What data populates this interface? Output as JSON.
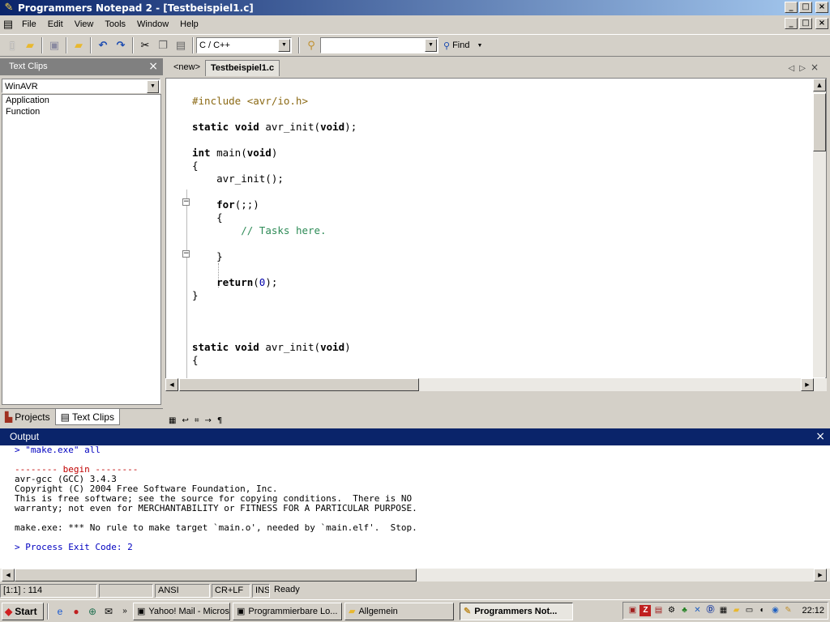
{
  "window": {
    "title": "Programmers Notepad 2 - [Testbeispiel1.c]",
    "caption_min": "_",
    "caption_max": "□",
    "caption_close": "×"
  },
  "menu": [
    "File",
    "Edit",
    "View",
    "Tools",
    "Window",
    "Help"
  ],
  "toolbar": {
    "scheme": "C / C++",
    "search_value": "",
    "find_label": "Find"
  },
  "text_clips": {
    "title": "Text Clips",
    "set": "WinAVR",
    "items": [
      "Application",
      "Function"
    ],
    "tabs": [
      "Projects",
      "Text Clips"
    ]
  },
  "document_tabs": [
    "<new>",
    "Testbeispiel1.c"
  ],
  "code_lines": [
    {
      "type": "blank",
      "text": ""
    },
    {
      "type": "pp",
      "text": "#include <avr/io.h>"
    },
    {
      "type": "blank",
      "text": ""
    },
    {
      "type": "proto",
      "kw": "static void",
      "name": " avr_init(",
      "kw2": "void",
      "rest": ");"
    },
    {
      "type": "blank",
      "text": ""
    },
    {
      "type": "main",
      "kw": "int",
      "name": " main(",
      "kw2": "void",
      "rest": ")"
    },
    {
      "type": "plain",
      "text": "{"
    },
    {
      "type": "plain",
      "text": "    avr_init();"
    },
    {
      "type": "blank",
      "text": ""
    },
    {
      "type": "for",
      "indent": "    ",
      "kw": "for",
      "rest": "(;;)"
    },
    {
      "type": "plain",
      "text": "    {"
    },
    {
      "type": "comment",
      "indent": "        ",
      "text": "// Tasks here."
    },
    {
      "type": "blank",
      "text": ""
    },
    {
      "type": "plain",
      "text": "    }"
    },
    {
      "type": "blank",
      "text": ""
    },
    {
      "type": "ret",
      "indent": "    ",
      "kw": "return",
      "open": "(",
      "num": "0",
      "close": ");"
    },
    {
      "type": "plain",
      "text": "}"
    },
    {
      "type": "blank",
      "text": ""
    },
    {
      "type": "blank",
      "text": ""
    },
    {
      "type": "blank",
      "text": ""
    },
    {
      "type": "proto",
      "kw": "static void",
      "name": " avr_init(",
      "kw2": "void",
      "rest": ")"
    },
    {
      "type": "plain",
      "text": "{"
    }
  ],
  "output": {
    "title": "Output",
    "lines": [
      {
        "cls": "blue",
        "text": "> \"make.exe\" all"
      },
      {
        "cls": "",
        "text": ""
      },
      {
        "cls": "red",
        "text": "-------- begin --------"
      },
      {
        "cls": "",
        "text": "avr-gcc (GCC) 3.4.3"
      },
      {
        "cls": "",
        "text": "Copyright (C) 2004 Free Software Foundation, Inc."
      },
      {
        "cls": "",
        "text": "This is free software; see the source for copying conditions.  There is NO"
      },
      {
        "cls": "",
        "text": "warranty; not even for MERCHANTABILITY or FITNESS FOR A PARTICULAR PURPOSE."
      },
      {
        "cls": "",
        "text": ""
      },
      {
        "cls": "",
        "text": "make.exe: *** No rule to make target `main.o', needed by `main.elf'.  Stop."
      },
      {
        "cls": "",
        "text": ""
      },
      {
        "cls": "blue",
        "text": "> Process Exit Code: 2"
      }
    ]
  },
  "status": {
    "position": "[1:1] : 114",
    "blank": "",
    "encoding": "ANSI",
    "line_ending": "CR+LF",
    "mode": "INS",
    "state": "Ready"
  },
  "taskbar": {
    "start": "Start",
    "tasks": [
      {
        "label": "Yahoo! Mail - Micros...",
        "active": false
      },
      {
        "label": "Programmierbare Lo...",
        "active": false
      },
      {
        "label": "Allgemein",
        "active": false
      },
      {
        "label": "Programmers Not...",
        "active": true
      }
    ],
    "clock": "22:12"
  }
}
